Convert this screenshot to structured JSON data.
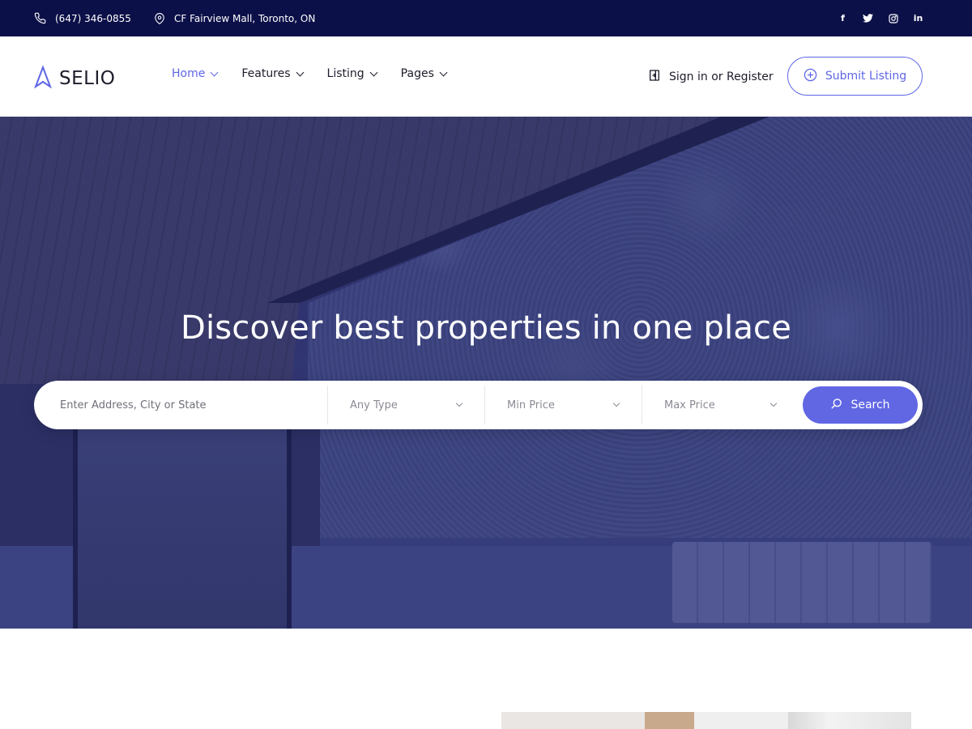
{
  "topbar": {
    "phone": "(647) 346-0855",
    "address": "CF Fairview Mall, Toronto, ON",
    "socials": [
      "facebook-icon",
      "twitter-icon",
      "instagram-icon",
      "linkedin-icon"
    ]
  },
  "header": {
    "logo_text": "SELIO",
    "nav": [
      {
        "label": "Home",
        "active": true
      },
      {
        "label": "Features",
        "active": false
      },
      {
        "label": "Listing",
        "active": false
      },
      {
        "label": "Pages",
        "active": false
      }
    ],
    "signin_label": "Sign in or Register",
    "submit_label": "Submit Listing"
  },
  "hero": {
    "title": "Discover best properties in one place"
  },
  "search": {
    "address_placeholder": "Enter Address, City or State",
    "type_value": "Any Type",
    "min_price_value": "Min Price",
    "max_price_value": "Max Price",
    "button_label": "Search"
  },
  "colors": {
    "accent": "#5f66e6",
    "topbar_bg": "#0c1048",
    "hero_overlay": "#2d3068"
  }
}
